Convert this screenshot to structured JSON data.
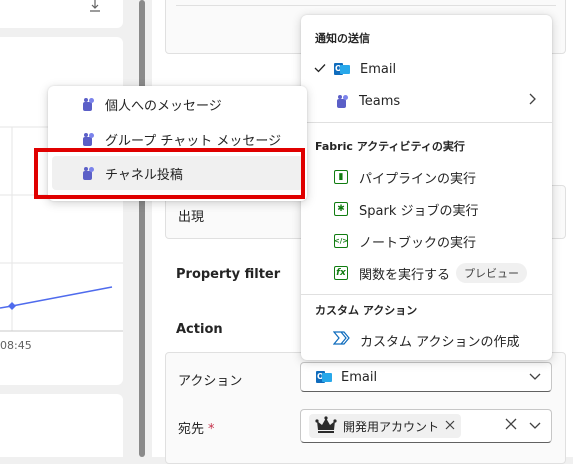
{
  "chart": {
    "x_tick_label": "08:45"
  },
  "form": {
    "field_start_label": "出現",
    "property_filter_label": "Property filter",
    "action_section_title": "Action",
    "action_field_label": "アクション",
    "action_value": "Email",
    "recipient_label": "宛先",
    "required_mark": "*",
    "recipient_chip": "開発用アカウント"
  },
  "notify_menu": {
    "header": "通知の送信",
    "items": [
      {
        "label": "Email",
        "icon": "outlook-icon",
        "checked": true
      },
      {
        "label": "Teams",
        "icon": "teams-icon",
        "has_submenu": true
      }
    ]
  },
  "fabric_menu": {
    "header": "Fabric アクティビティの実行",
    "items": [
      {
        "label": "パイプラインの実行",
        "icon": "pipeline-icon"
      },
      {
        "label": "Spark ジョブの実行",
        "icon": "spark-icon"
      },
      {
        "label": "ノートブックの実行",
        "icon": "notebook-icon"
      },
      {
        "label": "関数を実行する",
        "icon": "function-icon",
        "badge": "プレビュー"
      }
    ]
  },
  "custom_menu": {
    "header": "カスタム アクション",
    "items": [
      {
        "label": "カスタム アクションの作成",
        "icon": "custom-action-icon"
      }
    ]
  },
  "teams_submenu": {
    "items": [
      {
        "label": "個人へのメッセージ",
        "icon": "teams-icon"
      },
      {
        "label": "グループ チャット メッセージ",
        "icon": "teams-icon"
      },
      {
        "label": "チャネル投稿",
        "icon": "teams-icon",
        "highlighted": true
      }
    ]
  },
  "colors": {
    "accent": "#0f6cbd",
    "teams": "#5b5fc7",
    "highlight": "#e00000",
    "chart_line": "#4f6bed"
  }
}
